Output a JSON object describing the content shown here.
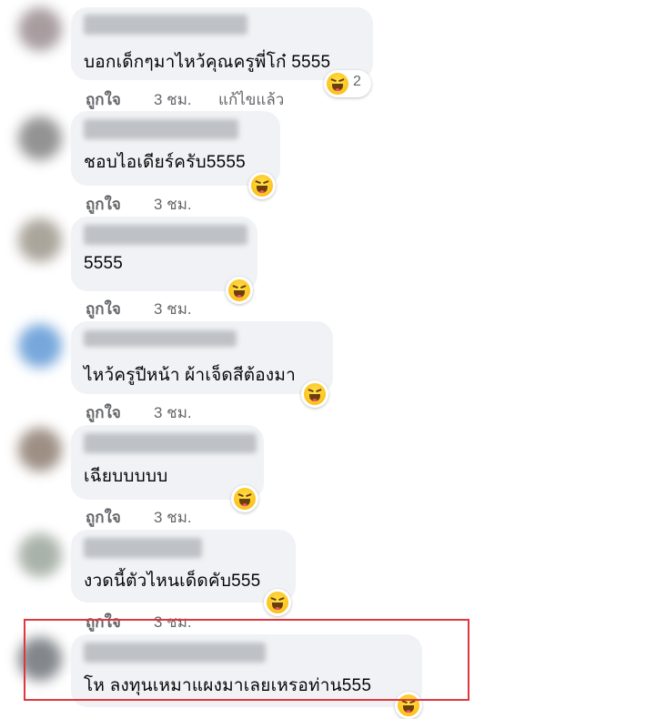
{
  "like_label": "ถูกใจ",
  "time_label": "3 ชม.",
  "edited_label": "แก้ไขแล้ว",
  "reaction_icon": "laugh-emoji-icon",
  "highlight_color": "#e0373f",
  "comments": [
    {
      "text": "บอกเด็กๆมาไหว้คุณครูพี่โก๋ 5555",
      "reaction_count": "2"
    },
    {
      "text": "ชอบไอเดียร์ครับ5555"
    },
    {
      "text": "5555"
    },
    {
      "text": "ไหว้ครูปีหน้า ผ้าเจ็ดสีต้องมา"
    },
    {
      "text": "เฉียบบบบบ"
    },
    {
      "text": "งวดนี้ตัวไหนเด็ดคับ555"
    },
    {
      "text": "โห ลงทุนเหมาแผงมาเลยเหรอท่าน555"
    }
  ]
}
